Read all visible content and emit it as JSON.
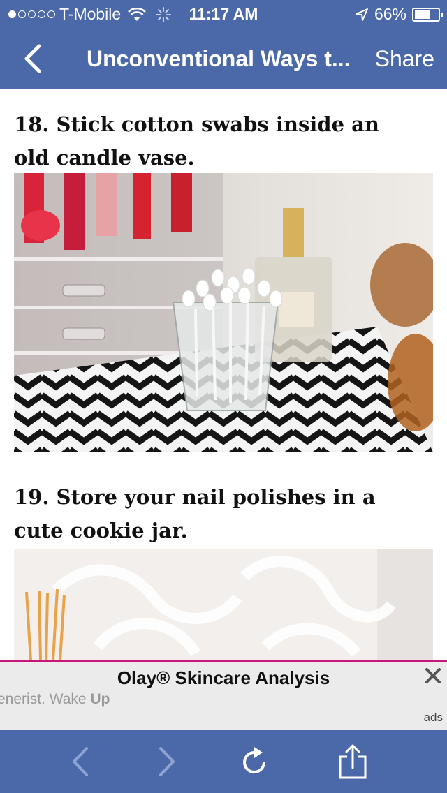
{
  "status_bar": {
    "carrier": "T-Mobile",
    "signal_bars": 1,
    "signal_total": 5,
    "time": "11:17 AM",
    "battery_percent": "66%",
    "battery_level": 0.66
  },
  "nav": {
    "title": "Unconventional Ways t...",
    "share_label": "Share",
    "back_icon": "chevron-left-icon"
  },
  "article": {
    "items": [
      {
        "heading": "18. Stick cotton swabs inside an old candle vase."
      },
      {
        "heading": "19. Store your nail polishes in a cute cookie jar."
      }
    ]
  },
  "ad": {
    "title": "Olay® Skincare Analysis",
    "text_prefix": "enerist. Wake ",
    "text_bold": "Up",
    "label": "ads",
    "close_icon": "close-icon",
    "accent_color": "#c7157a"
  },
  "toolbar": {
    "icons": [
      "back-arrow-icon",
      "forward-arrow-icon",
      "reload-icon",
      "share-icon"
    ]
  },
  "colors": {
    "brand_blue": "#4b68a8",
    "toolbar_disabled": "#8ea3cf"
  }
}
